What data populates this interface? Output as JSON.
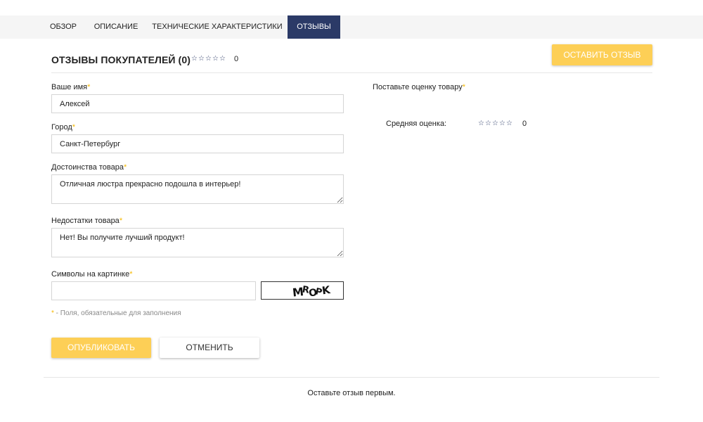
{
  "tabs": [
    {
      "label": "Обзор"
    },
    {
      "label": "Описание"
    },
    {
      "label": "Технические характеристики"
    },
    {
      "label": "Отзывы"
    }
  ],
  "reviews_header": {
    "title": "ОТЗЫВЫ ПОКУПАТЕЛЕЙ (0)",
    "rating_value": "0",
    "leave_review_label": "ОСТАВИТЬ ОТЗЫВ"
  },
  "form": {
    "name": {
      "label": "Ваше имя",
      "value": "Алексей"
    },
    "city": {
      "label": "Город",
      "value": "Санкт-Петербург"
    },
    "pros": {
      "label": "Достоинства товара",
      "value": "Отличная люстра прекрасно подошла в интерьер!"
    },
    "cons": {
      "label": "Недостатки товара",
      "value": "Нет! Вы получите лучший продукт!"
    },
    "captcha": {
      "label": "Символы на картинке",
      "value": "",
      "image_text": "MROPK"
    },
    "required_mark": "*",
    "required_note": " - Поля, обязательные для заполнения",
    "publish_label": "ОПУБЛИКОВАТЬ",
    "cancel_label": "ОТМЕНИТЬ"
  },
  "rating_panel": {
    "set_rating_label": "Поставьте оценку товару",
    "average_label": "Средняя оценка:",
    "average_value": "0"
  },
  "empty_message": "Оставьте отзыв первым.",
  "colors": {
    "accent_navy": "#2b3a67",
    "accent_yellow": "#fdcf56",
    "required": "#f5b800"
  },
  "icons": {
    "star": "empty-star-icon"
  }
}
